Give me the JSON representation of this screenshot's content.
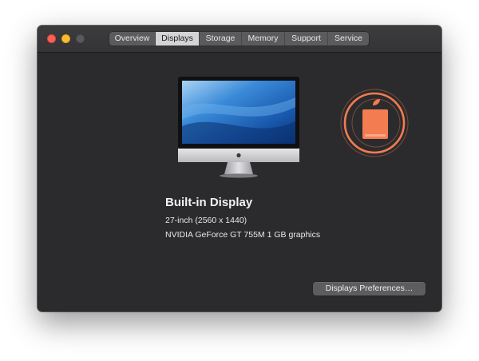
{
  "window": {
    "traffic_lights": [
      "close",
      "minimize",
      "zoom"
    ]
  },
  "tabs": [
    {
      "label": "Overview",
      "active": false
    },
    {
      "label": "Displays",
      "active": true
    },
    {
      "label": "Storage",
      "active": false
    },
    {
      "label": "Memory",
      "active": false
    },
    {
      "label": "Support",
      "active": false
    },
    {
      "label": "Service",
      "active": false
    }
  ],
  "display": {
    "image": "imac-illustration",
    "name": "Built-in Display",
    "size": "27-inch (2560 x 1440)",
    "graphics": "NVIDIA GeForce GT 755M 1 GB graphics"
  },
  "badge": {
    "icon": "orange-apple-badge-icon",
    "accent": "#f47c51"
  },
  "actions": {
    "preferences_label": "Displays Preferences…"
  }
}
